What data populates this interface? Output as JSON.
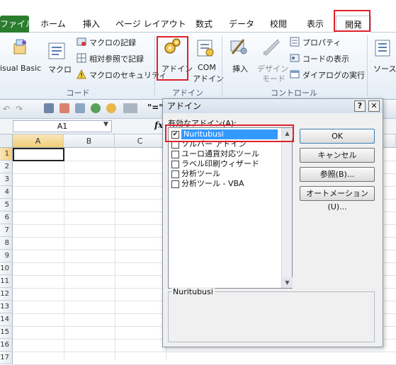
{
  "ribbon": {
    "tabs": [
      "ファイル",
      "ホーム",
      "挿入",
      "ページ レイアウト",
      "数式",
      "データ",
      "校閲",
      "表示",
      "開発"
    ],
    "code_group": {
      "visual_basic": "isual Basic",
      "macro": "マクロ",
      "record": "マクロの記録",
      "relative": "相対参照で記録",
      "security": "マクロのセキュリティ",
      "label": "コード"
    },
    "addin_group": {
      "addin": "アドイン",
      "com": "COM",
      "com2": "アドイン",
      "label": "アドイン"
    },
    "control_group": {
      "insert": "挿入",
      "design": "デザイン",
      "design2": "モード",
      "props": "プロパティ",
      "view_code": "コードの表示",
      "dialog": "ダイアログの実行",
      "label": "コントロール"
    },
    "source": "ソース"
  },
  "formula_bar": {
    "name_box": "A1",
    "fx": "fx"
  },
  "sheet": {
    "columns": [
      "A",
      "B",
      "C"
    ],
    "rows": [
      "1",
      "2",
      "3",
      "4",
      "5",
      "6",
      "7",
      "8",
      "9",
      "10",
      "11",
      "12",
      "13",
      "14",
      "15",
      "16",
      "17"
    ]
  },
  "dialog": {
    "title": "アドイン",
    "help": "?",
    "close": "✕",
    "list_label": "有効なアドイン(A):",
    "items": [
      {
        "label": "Nuritubusi",
        "checked": true
      },
      {
        "label": "ソルバー アドイン",
        "checked": false
      },
      {
        "label": "ユーロ通貨対応ツール",
        "checked": false
      },
      {
        "label": "ラベル印刷ウィザード",
        "checked": false
      },
      {
        "label": "分析ツール",
        "checked": false
      },
      {
        "label": "分析ツール - VBA",
        "checked": false
      }
    ],
    "buttons": {
      "ok": "OK",
      "cancel": "キャンセル",
      "browse": "参照(B)...",
      "automation": "オートメーション(U)..."
    },
    "description_title": "Nuritubusi"
  }
}
